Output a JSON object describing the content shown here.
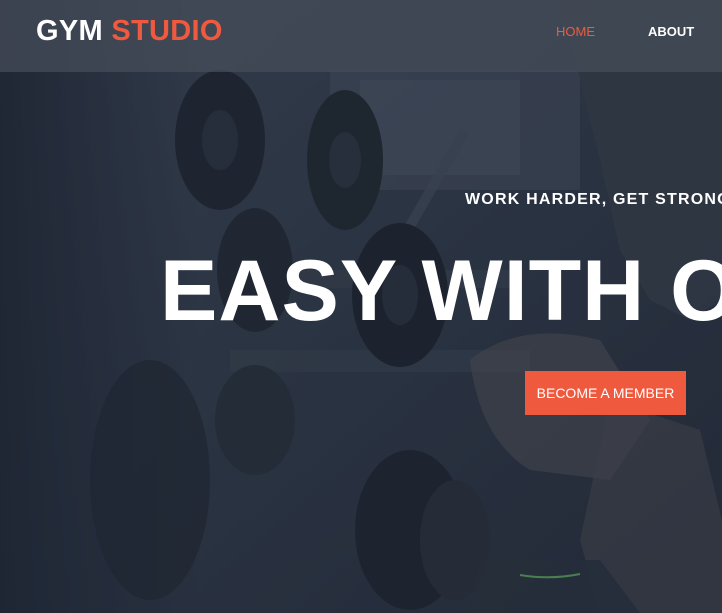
{
  "brand": {
    "first": "GYM",
    "second": "STUDIO",
    "accent_color": "#ef5a3f"
  },
  "nav": {
    "items": [
      {
        "label": "HOME",
        "active": true
      },
      {
        "label": "ABOUT",
        "active": false
      }
    ]
  },
  "hero": {
    "tagline": "WORK HARDER, GET STRONG",
    "headline": "EASY WITH OUR GYM",
    "cta_label": "BECOME A MEMBER"
  }
}
